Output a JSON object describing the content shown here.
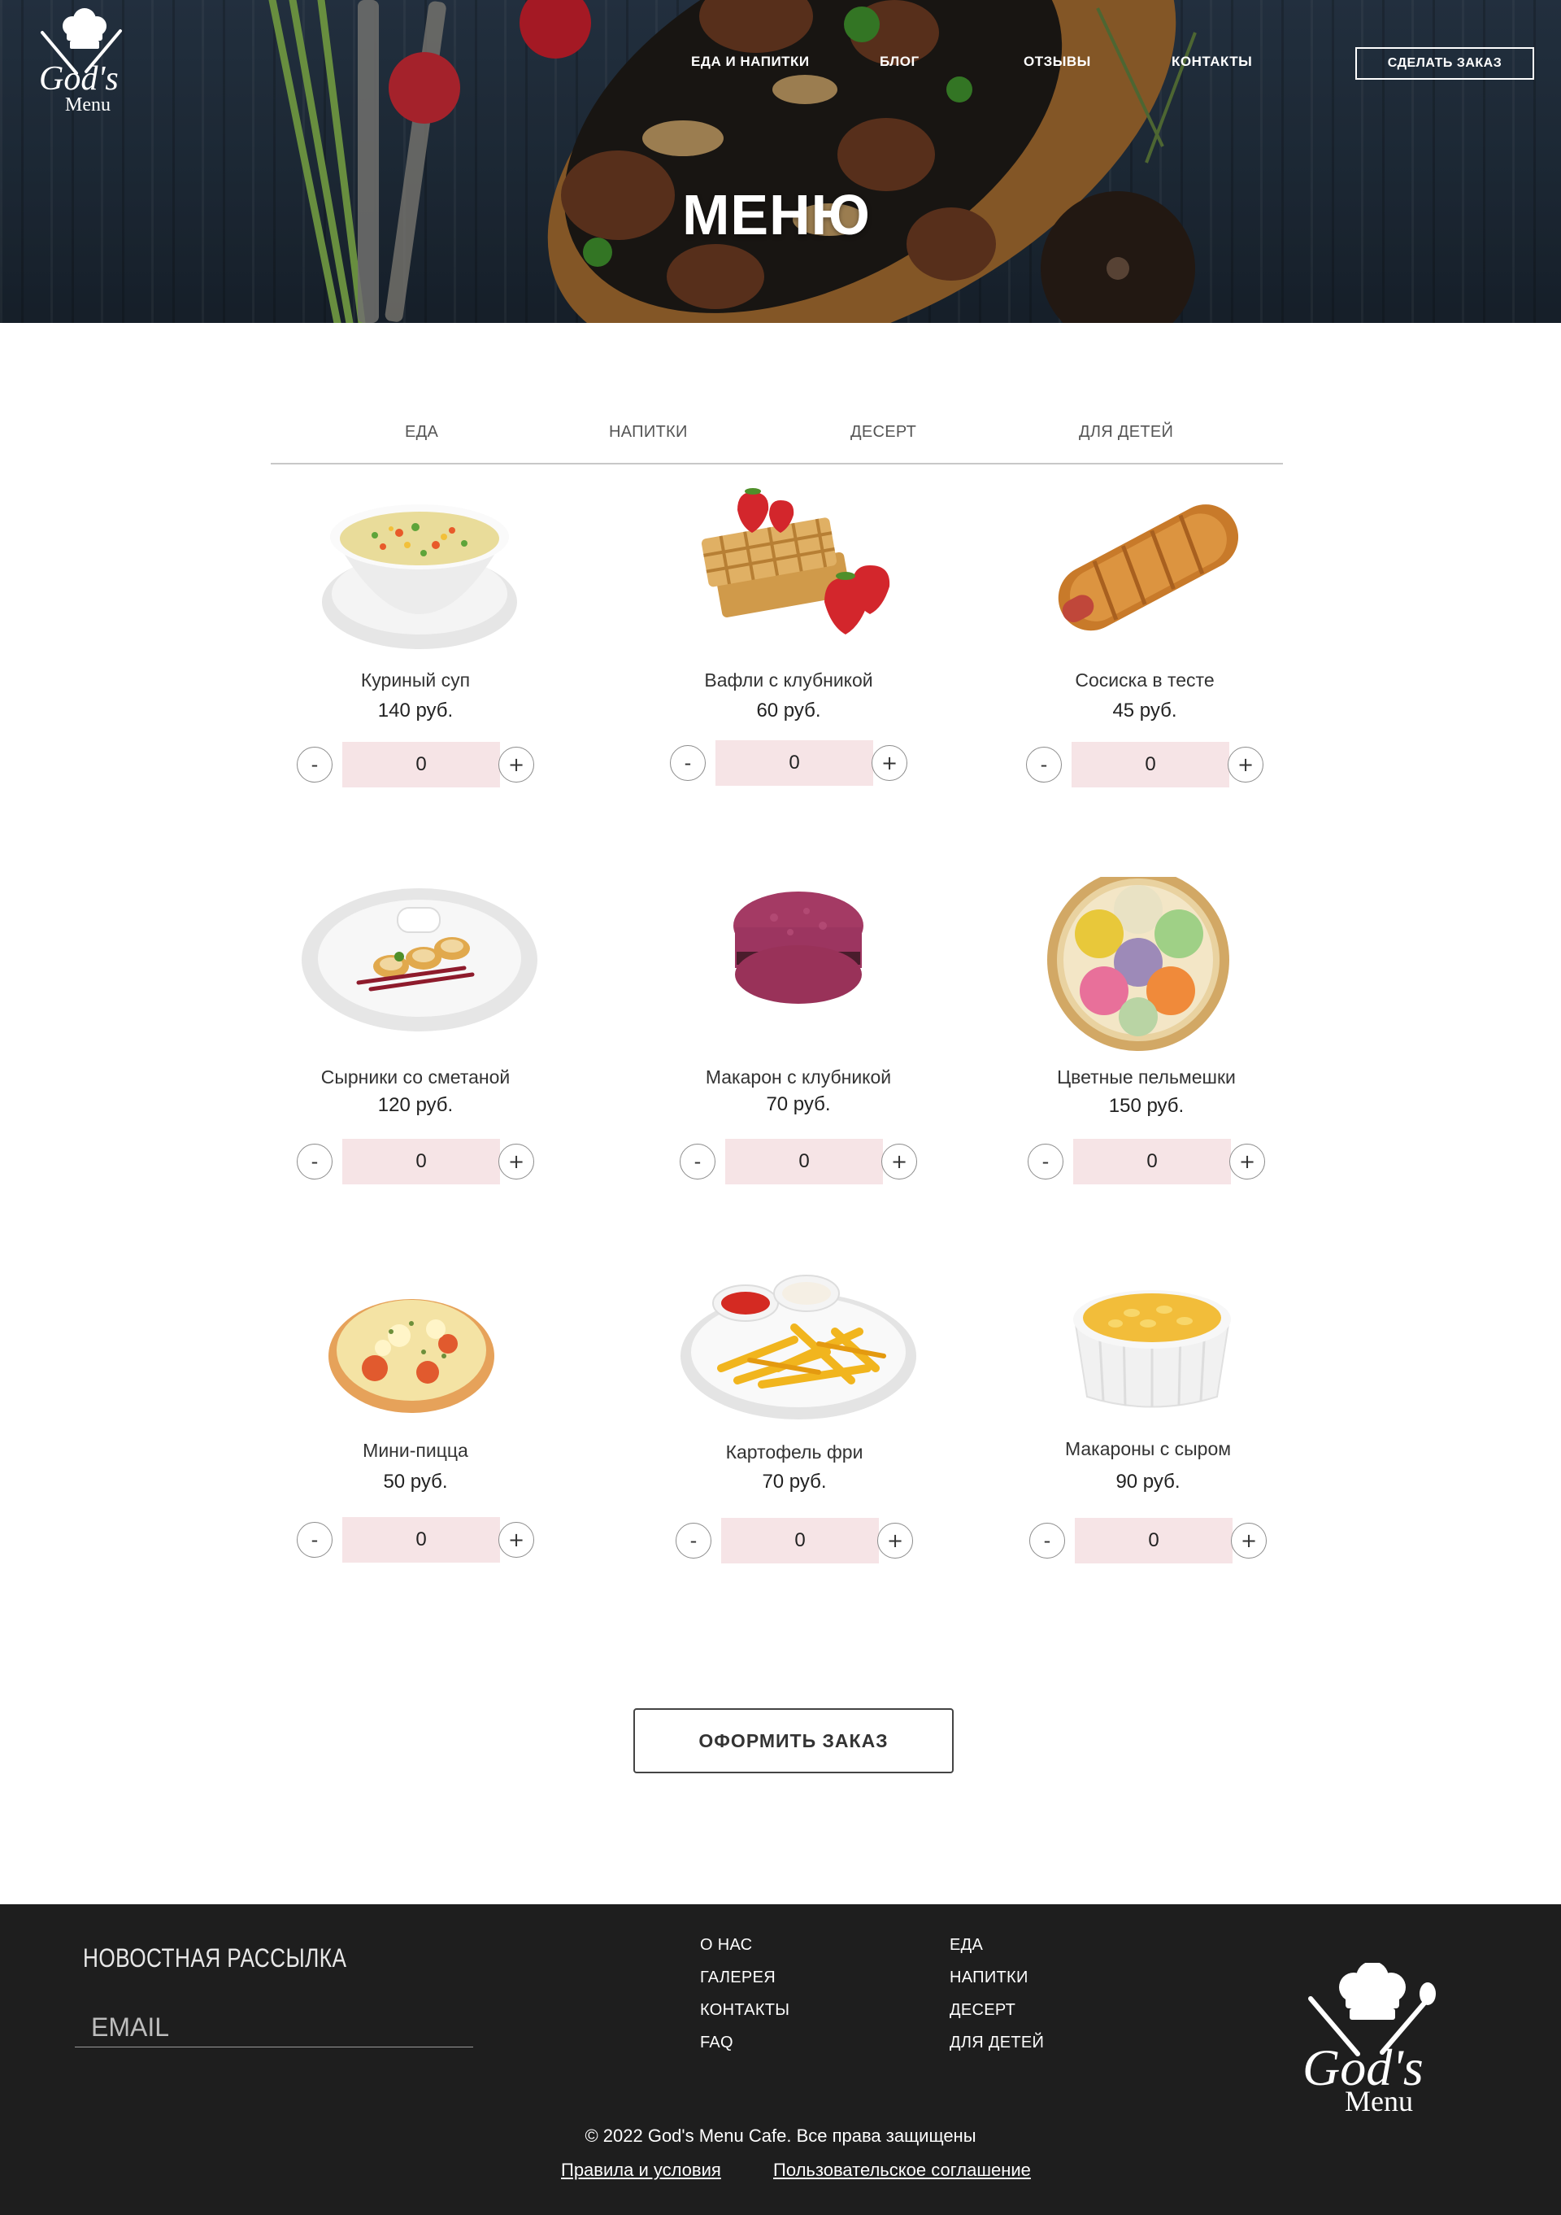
{
  "header": {
    "logo_text": {
      "line1": "God's",
      "line2": "Menu"
    },
    "nav": [
      "ЕДА И НАПИТКИ",
      "БЛОГ",
      "ОТЗЫВЫ",
      "КОНТАКТЫ"
    ],
    "order_button": "СДЕЛАТЬ ЗАКАЗ",
    "title": "МЕНЮ"
  },
  "tabs": [
    "ЕДА",
    "НАПИТКИ",
    "ДЕСЕРТ",
    "ДЛЯ ДЕТЕЙ"
  ],
  "items": [
    {
      "name": "Куриный суп",
      "price": "140 руб.",
      "qty": "0",
      "image": "soup-bowl"
    },
    {
      "name": "Вафли с клубникой",
      "price": "60 руб.",
      "qty": "0",
      "image": "waffles-strawberry"
    },
    {
      "name": "Сосиска в тесте",
      "price": "45 руб.",
      "qty": "0",
      "image": "sausage-roll"
    },
    {
      "name": "Сырники со сметаной",
      "price": "120 руб.",
      "qty": "0",
      "image": "syrniki-plate"
    },
    {
      "name": "Макарон с клубникой",
      "price": "70 руб.",
      "qty": "0",
      "image": "macaron"
    },
    {
      "name": "Цветные пельмешки",
      "price": "150 руб.",
      "qty": "0",
      "image": "colored-dumplings"
    },
    {
      "name": "Мини-пицца",
      "price": "50 руб.",
      "qty": "0",
      "image": "mini-pizza"
    },
    {
      "name": "Картофель фри",
      "price": "70 руб.",
      "qty": "0",
      "image": "french-fries"
    },
    {
      "name": "Макароны с сыром",
      "price": "90 руб.",
      "qty": "0",
      "image": "mac-and-cheese"
    }
  ],
  "qty_controls": {
    "minus": "-",
    "plus": "+"
  },
  "checkout_button": "ОФОРМИТЬ ЗАКАЗ",
  "footer": {
    "newsletter_title": "НОВОСТНАЯ РАССЫЛКА",
    "email_placeholder": "EMAIL",
    "links_col1": [
      "О НАС",
      "ГАЛЕРЕЯ",
      "КОНТАКТЫ",
      "FAQ"
    ],
    "links_col2": [
      "ЕДА",
      "НАПИТКИ",
      "ДЕСЕРТ",
      "ДЛЯ ДЕТЕЙ"
    ],
    "copyright": "© 2022 God's Menu Cafe. Все права защищены",
    "terms": "Правила и условия",
    "agreement": "Пользовательское соглашение"
  },
  "colors": {
    "qty_bg": "#f6e4e6",
    "footer_bg": "#1e1e1e",
    "hero_bg": "#22303f"
  }
}
